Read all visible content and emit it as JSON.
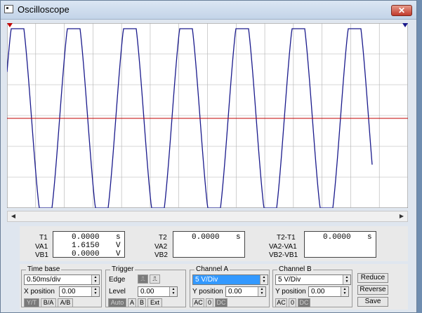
{
  "window": {
    "title": "Oscilloscope",
    "close_label": "✕"
  },
  "readouts": [
    {
      "id": "T1",
      "rows": [
        {
          "label": "T1",
          "value": "0.0000",
          "unit": "s"
        },
        {
          "label": "VA1",
          "value": "1.6150",
          "unit": "V"
        },
        {
          "label": "VB1",
          "value": "0.0000",
          "unit": "V"
        }
      ]
    },
    {
      "id": "T2",
      "rows": [
        {
          "label": "T2",
          "value": "0.0000",
          "unit": "s"
        },
        {
          "label": "VA2",
          "value": "",
          "unit": ""
        },
        {
          "label": "VB2",
          "value": "",
          "unit": ""
        }
      ]
    },
    {
      "id": "T2-T1",
      "rows": [
        {
          "label": "T2-T1",
          "value": "0.0000",
          "unit": "s"
        },
        {
          "label": "VA2-VA1",
          "value": "",
          "unit": ""
        },
        {
          "label": "VB2-VB1",
          "value": "",
          "unit": ""
        }
      ]
    }
  ],
  "timebase": {
    "title": "Time base",
    "scale": "0.50ms/div",
    "xpos_label": "X position",
    "xpos": "0.00",
    "modes": [
      "Y/T",
      "B/A",
      "A/B"
    ],
    "active_mode": "Y/T"
  },
  "trigger": {
    "title": "Trigger",
    "edge_label": "Edge",
    "level_label": "Level",
    "level": "0.00",
    "sources": [
      "Auto",
      "A",
      "B",
      "Ext"
    ],
    "active_source": "Auto"
  },
  "channel_a": {
    "title": "Channel A",
    "scale": "5 V/Div",
    "ypos_label": "Y position",
    "ypos": "0.00",
    "coupling": [
      "AC",
      "0",
      "DC"
    ],
    "active_coupling": "DC"
  },
  "channel_b": {
    "title": "Channel B",
    "scale": "5 V/Div",
    "ypos_label": "Y position",
    "ypos": "0.00",
    "coupling": [
      "AC",
      "0",
      "DC"
    ],
    "active_coupling": "DC"
  },
  "actions": [
    "Reduce",
    "Reverse",
    "Save"
  ],
  "colors": {
    "trace_a": "#1a1a8c",
    "trace_b": "#c00000",
    "grid": "#b0b0b0",
    "screen_bg": "#ffffff"
  }
}
